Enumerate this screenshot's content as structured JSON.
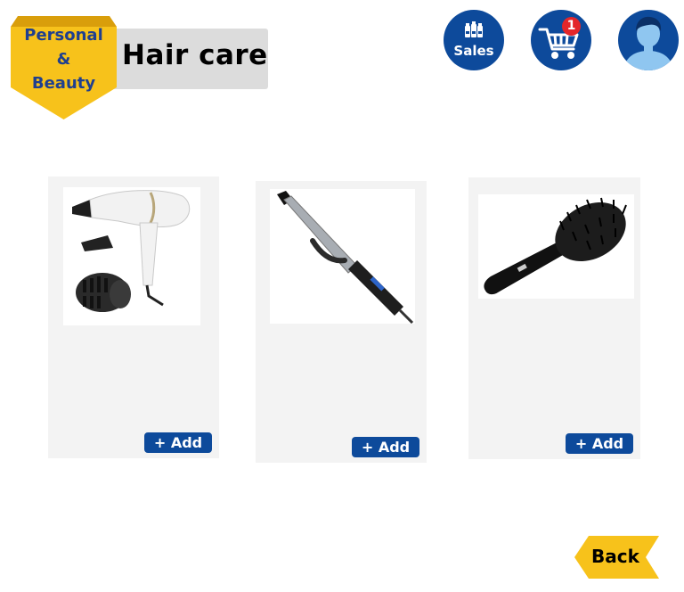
{
  "header": {
    "category_line1": "Personal",
    "category_line2": "&",
    "category_line3": "Beauty",
    "page_title": "Hair care"
  },
  "nav": {
    "sales_label": "Sales",
    "cart_count": "1",
    "icons": [
      "sales-icon",
      "shopping-cart-icon",
      "user-profile-icon"
    ]
  },
  "products": [
    {
      "name": "hair-dryer",
      "add_label": "+ Add"
    },
    {
      "name": "curling-iron",
      "add_label": "+ Add"
    },
    {
      "name": "hair-brush",
      "add_label": "+ Add"
    }
  ],
  "footer": {
    "back_label": "Back"
  },
  "colors": {
    "brand_blue": "#0d4a9b",
    "badge_yellow": "#f7c21b",
    "card_bg": "#f3f3f3",
    "cart_badge_red": "#e3262a"
  }
}
